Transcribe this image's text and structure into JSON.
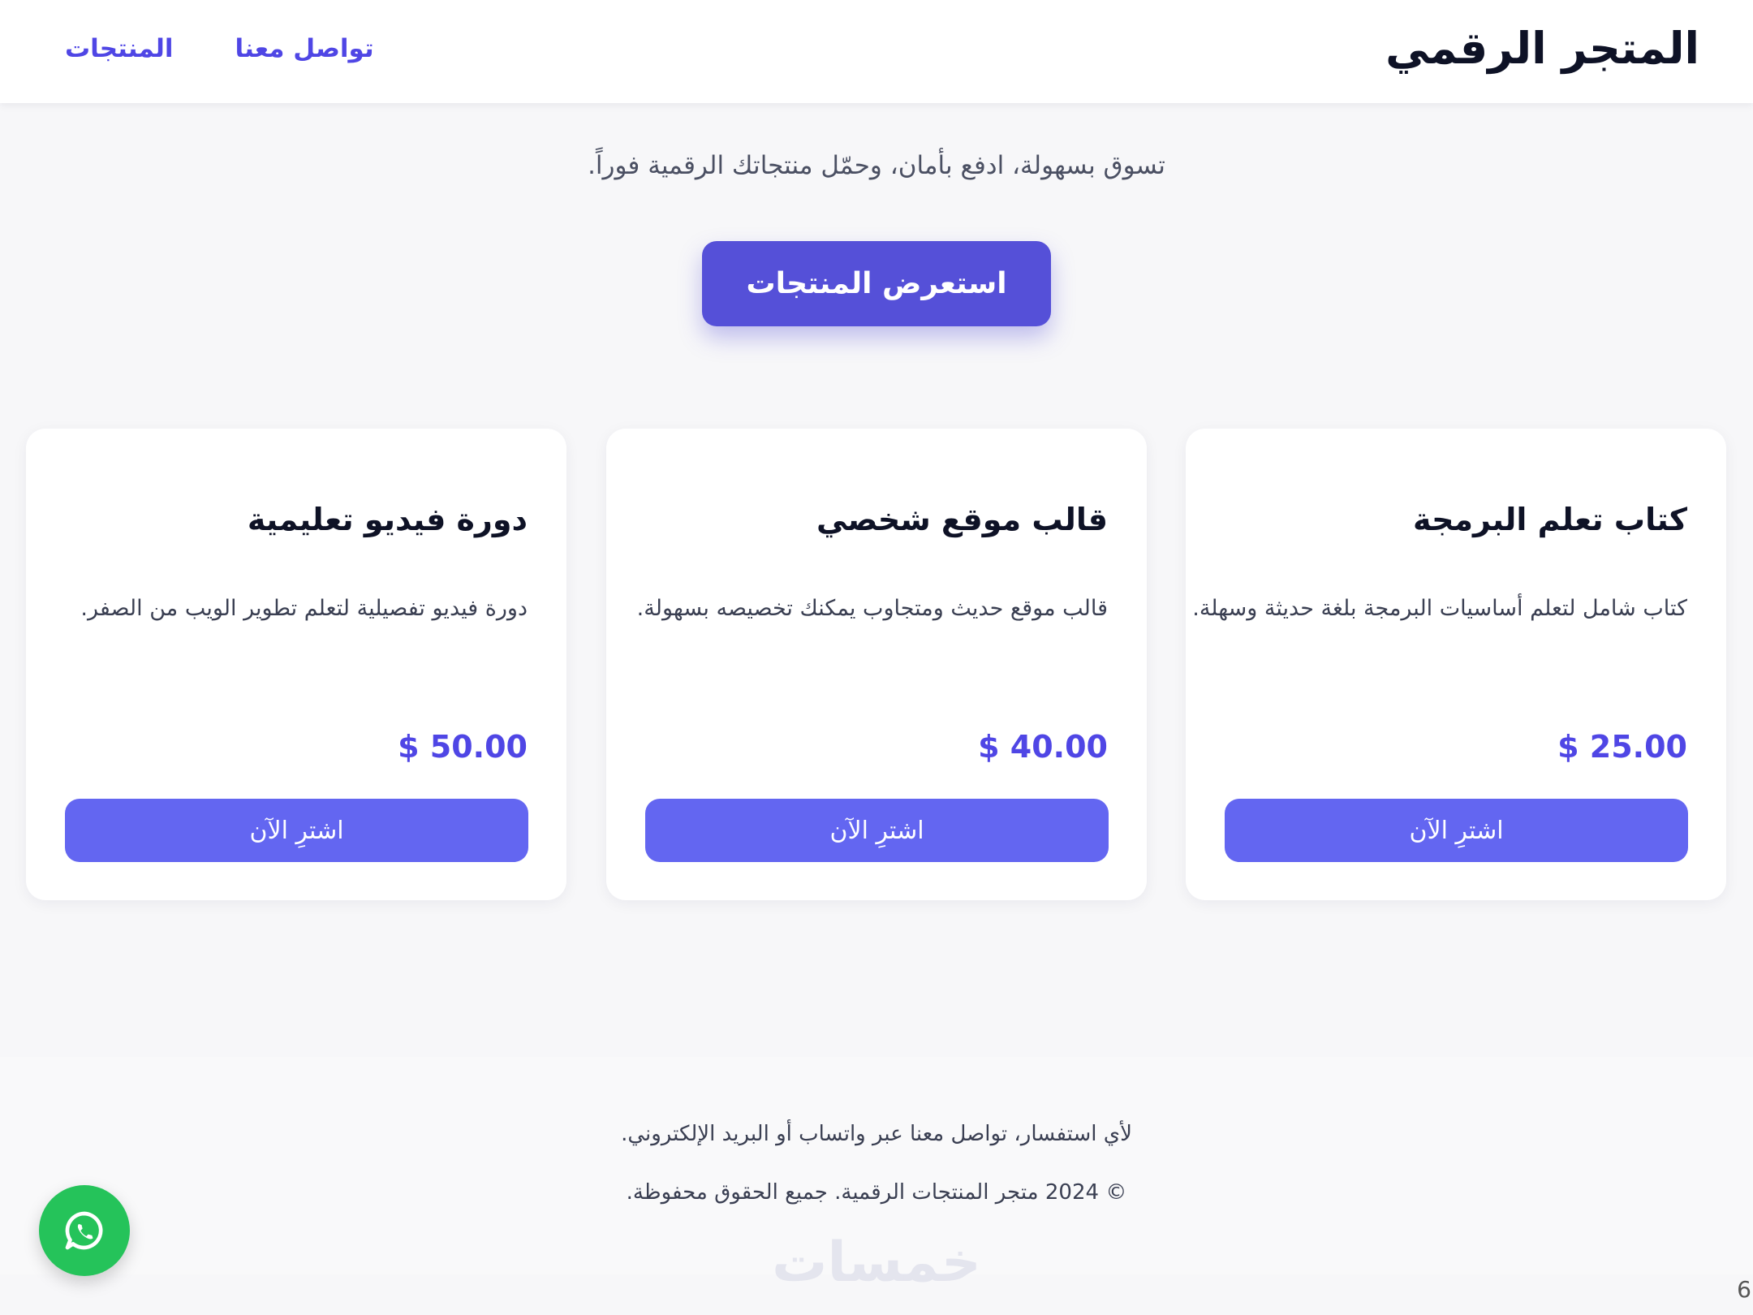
{
  "header": {
    "brand": "المتجر الرقمي",
    "nav": {
      "products": "المنتجات",
      "contact": "تواصل معنا"
    }
  },
  "hero": {
    "subtitle": "تسوق بسهولة، ادفع بأمان، وحمّل منتجاتك الرقمية فوراً.",
    "cta": "استعرض المنتجات"
  },
  "products": [
    {
      "title": "كتاب تعلم البرمجة",
      "description": "كتاب شامل لتعلم أساسيات البرمجة بلغة حديثة وسهلة.",
      "price": "$ 25.00",
      "buy": "اشترِ الآن"
    },
    {
      "title": "قالب موقع شخصي",
      "description": "قالب موقع حديث ومتجاوب يمكنك تخصيصه بسهولة.",
      "price": "$ 40.00",
      "buy": "اشترِ الآن"
    },
    {
      "title": "دورة فيديو تعليمية",
      "description": "دورة فيديو تفصيلية لتعلم تطوير الويب من الصفر.",
      "price": "$ 50.00",
      "buy": "اشترِ الآن"
    }
  ],
  "footer": {
    "contact": "لأي استفسار، تواصل معنا عبر واتساب أو البريد الإلكتروني.",
    "copyright": "© 2024 متجر المنتجات الرقمية. جميع الحقوق محفوظة."
  },
  "watermark": "خمسات",
  "page_number": "6",
  "floating": {
    "icon": "whatsapp-icon"
  },
  "colors": {
    "accent": "#4f46e5",
    "button": "#6366f1",
    "cta": "#5550d8",
    "whatsapp": "#25c35a"
  }
}
